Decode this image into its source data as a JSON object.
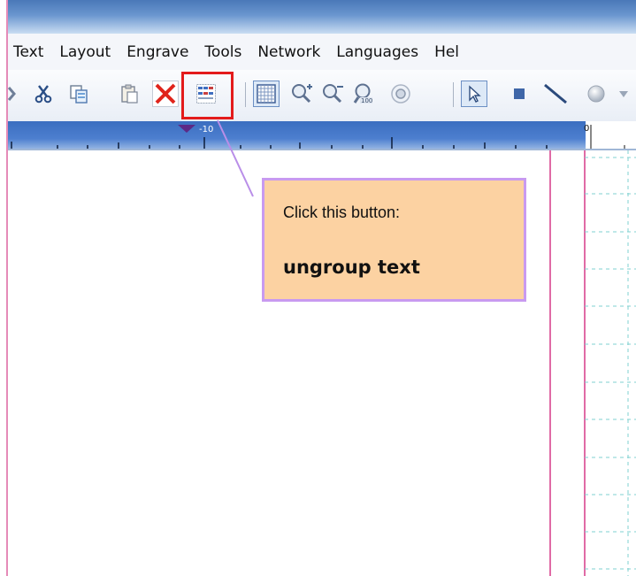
{
  "menu": {
    "items": [
      {
        "label": "Text"
      },
      {
        "label": "Layout"
      },
      {
        "label": "Engrave"
      },
      {
        "label": "Tools"
      },
      {
        "label": "Network"
      },
      {
        "label": "Languages"
      },
      {
        "label": "Hel"
      }
    ]
  },
  "toolbar": {
    "buttons": [
      "partial-icon",
      "cut-icon",
      "copy-icon",
      "paste-icon",
      "delete-icon",
      "ungroup-text-icon",
      "grid-icon",
      "zoom-in-icon",
      "zoom-out-icon",
      "zoom-100-icon",
      "zoom-fit-icon",
      "select-pointer-icon",
      "rectangle-icon",
      "line-icon",
      "ellipse-icon"
    ],
    "highlighted_button": "ungroup-text-icon",
    "highlight_color": "#e31b1b"
  },
  "ruler": {
    "label_minus10": "-10",
    "label_zero": "0"
  },
  "callout": {
    "line1": "Click this button:",
    "line2": "ungroup text",
    "background": "#fcd2a2",
    "border": "#c89af0"
  },
  "colors": {
    "title_bar": "#4a78b8",
    "ruler": "#3b6ec0",
    "margin_line": "#d63a88",
    "grid_line": "#7fd0d0"
  }
}
